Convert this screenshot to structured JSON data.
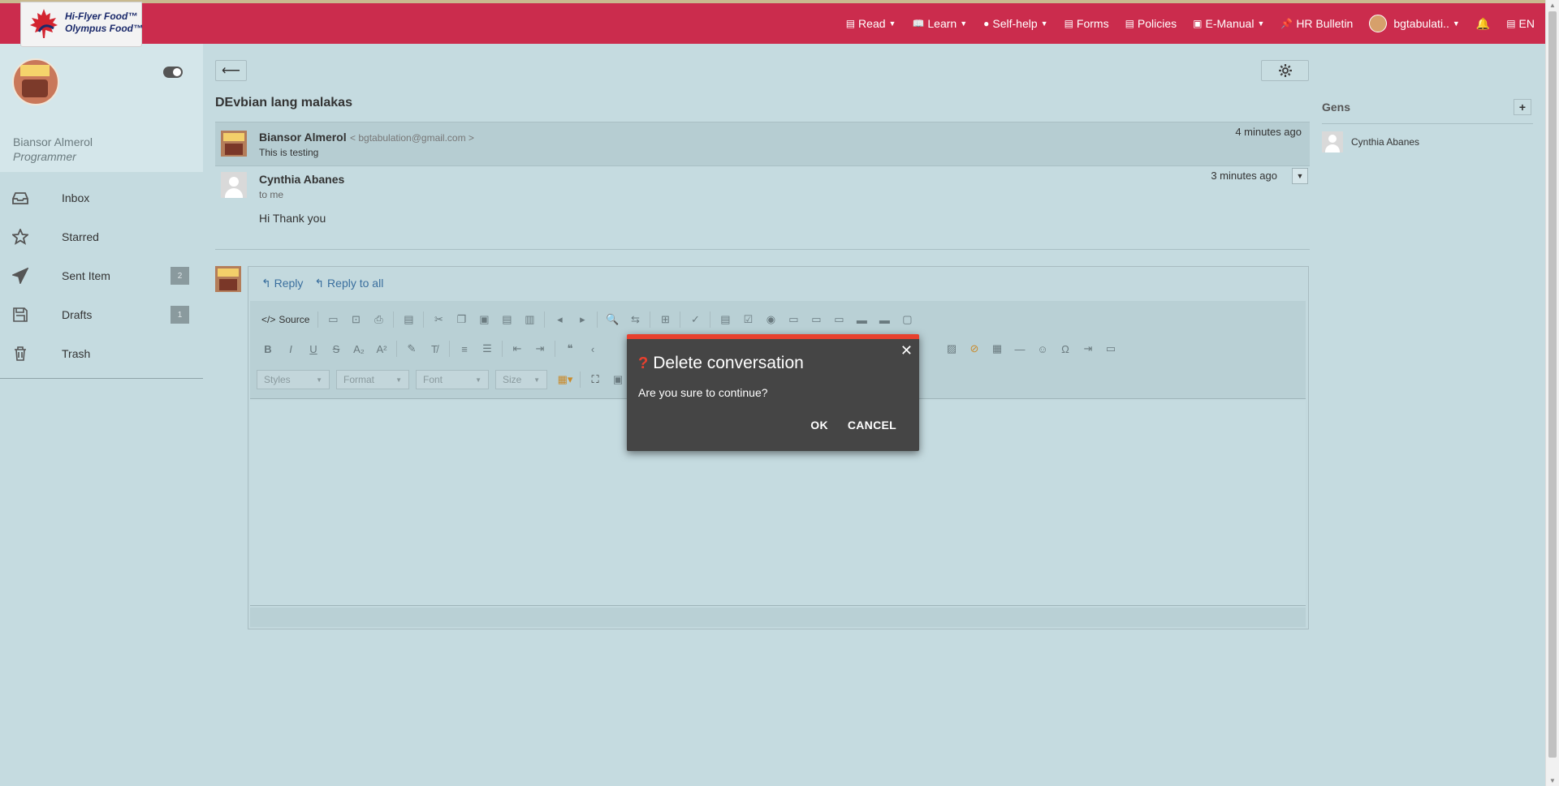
{
  "brand": {
    "line1": "Hi-Flyer Food™",
    "line2": "Olympus Food™"
  },
  "nav": [
    {
      "label": "Read",
      "icon": "newspaper-icon",
      "dropdown": true
    },
    {
      "label": "Learn",
      "icon": "book-icon",
      "dropdown": true
    },
    {
      "label": "Self-help",
      "icon": "help-circle-icon",
      "dropdown": true
    },
    {
      "label": "Forms",
      "icon": "form-icon",
      "dropdown": false
    },
    {
      "label": "Policies",
      "icon": "policy-icon",
      "dropdown": false
    },
    {
      "label": "E-Manual",
      "icon": "manual-icon",
      "dropdown": true
    },
    {
      "label": "HR Bulletin",
      "icon": "pin-icon",
      "dropdown": false
    }
  ],
  "user_menu": {
    "label": "bgtabulati..",
    "dropdown": true
  },
  "language": "EN",
  "profile": {
    "name": "Biansor Almerol",
    "role": "Programmer"
  },
  "menu": [
    {
      "label": "Inbox",
      "icon": "inbox-icon",
      "count": null
    },
    {
      "label": "Starred",
      "icon": "star-icon",
      "count": null
    },
    {
      "label": "Sent Item",
      "icon": "paper-plane-icon",
      "count": "2"
    },
    {
      "label": "Drafts",
      "icon": "floppy-icon",
      "count": "1"
    },
    {
      "label": "Trash",
      "icon": "trash-icon",
      "count": null
    }
  ],
  "conversation": {
    "subject": "DEvbian lang malakas",
    "messages": [
      {
        "sender": "Biansor Almerol",
        "email": "< bgtabulation@gmail.com >",
        "snippet": "This is testing",
        "time": "4 minutes ago"
      },
      {
        "sender": "Cynthia Abanes",
        "to": "to me",
        "body": "Hi Thank you",
        "time": "3 minutes ago"
      }
    ]
  },
  "reply": {
    "reply_label": "Reply",
    "reply_all_label": "Reply to all"
  },
  "editor": {
    "source_label": "Source",
    "combos": [
      "Styles",
      "Format",
      "Font",
      "Size"
    ]
  },
  "modal": {
    "title": "Delete conversation",
    "message": "Are you sure to continue?",
    "ok_label": "OK",
    "cancel_label": "CANCEL"
  },
  "right_panel": {
    "title": "Gens",
    "members": [
      "Cynthia Abanes"
    ]
  },
  "colors": {
    "navbar": "#cb2c4d",
    "modal_bg": "#454545",
    "modal_accent": "#e8402e",
    "link": "#3a6f9e"
  }
}
